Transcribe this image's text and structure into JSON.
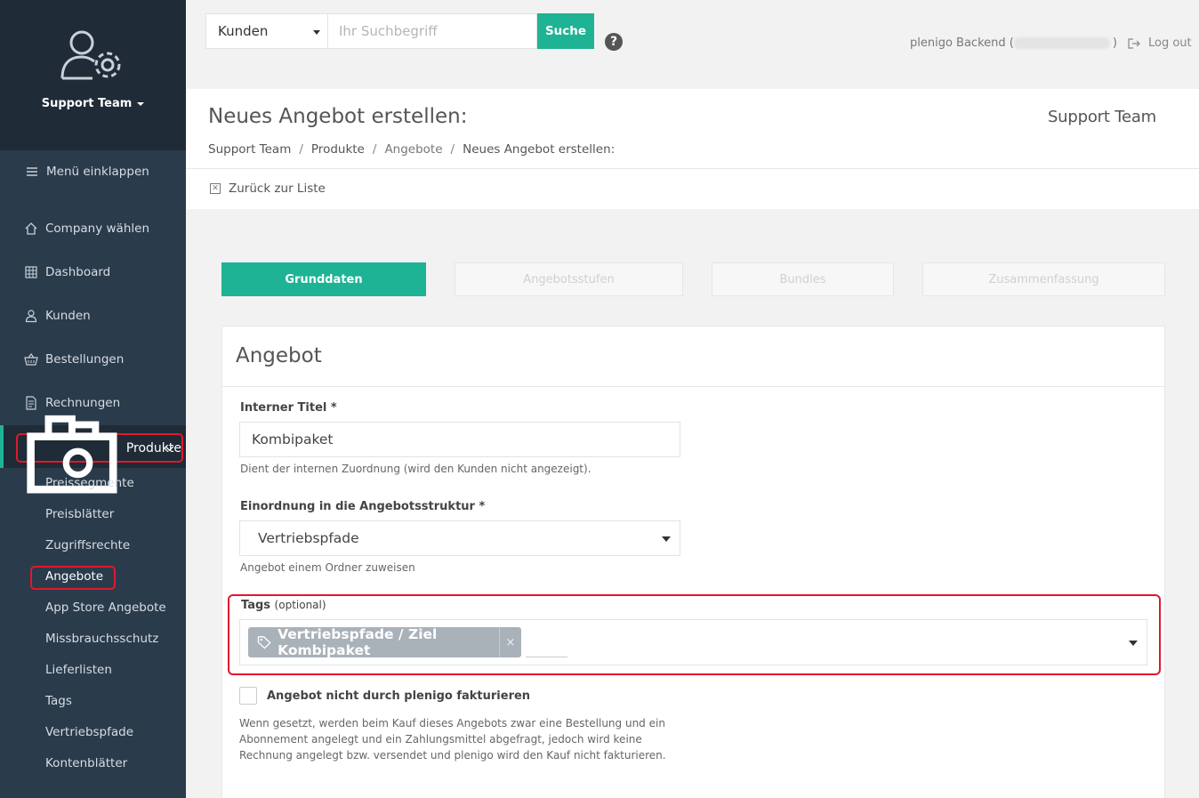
{
  "sidebar": {
    "team_name": "Support Team",
    "collapse_label": "Menü einklappen",
    "items": [
      {
        "label": "Company wählen",
        "icon": "home-icon"
      },
      {
        "label": "Dashboard",
        "icon": "grid-icon"
      },
      {
        "label": "Kunden",
        "icon": "user-icon"
      },
      {
        "label": "Bestellungen",
        "icon": "basket-icon"
      },
      {
        "label": "Rechnungen",
        "icon": "document-icon"
      }
    ],
    "active_item": {
      "label": "Produkte",
      "icon": "products-icon"
    },
    "subitems": [
      "Preissegmente",
      "Preisblätter",
      "Zugriffsrechte",
      "Angebote",
      "App Store Angebote",
      "Missbrauchsschutz",
      "Lieferlisten",
      "Tags",
      "Vertriebspfade",
      "Kontenblätter"
    ]
  },
  "topbar": {
    "search_scope": "Kunden",
    "search_placeholder": "Ihr Suchbegriff",
    "search_button": "Suche",
    "help": "?",
    "backend_prefix": "plenigo Backend (",
    "backend_suffix": ")",
    "logout": "Log out"
  },
  "header": {
    "title": "Neues Angebot erstellen:",
    "brand": "Support Team",
    "breadcrumb": [
      "Support Team",
      "Produkte",
      "Angebote",
      "Neues Angebot erstellen:"
    ],
    "separator": "/",
    "back_link": "Zurück zur Liste"
  },
  "steps": [
    "Grunddaten",
    "Angebotsstufen",
    "Bundles",
    "Zusammenfassung"
  ],
  "form": {
    "card_title": "Angebot",
    "internal_title_label": "Interner Titel *",
    "internal_title_value": "Kombipaket",
    "internal_title_hint": "Dient der internen Zuordnung (wird den Kunden nicht angezeigt).",
    "structure_label": "Einordnung in die Angebotsstruktur *",
    "structure_value": "Vertriebspfade",
    "structure_hint": "Angebot einem Ordner zuweisen",
    "tags_label": "Tags",
    "tags_optional": "(optional)",
    "tag_chip": "Vertriebspfade / Ziel Kombipaket",
    "tag_remove": "×",
    "no_invoice_label": "Angebot nicht durch plenigo fakturieren",
    "no_invoice_desc": "Wenn gesetzt, werden beim Kauf dieses Angebots zwar eine Bestellung und ein Abonnement angelegt und ein Zahlungsmittel abgefragt, jedoch wird keine Rechnung angelegt bzw. versendet und plenigo wird den Kauf nicht fakturieren."
  },
  "colors": {
    "accent": "#1eb394",
    "sidebar_bg": "#2a3b4c",
    "highlight": "#e0182d"
  }
}
